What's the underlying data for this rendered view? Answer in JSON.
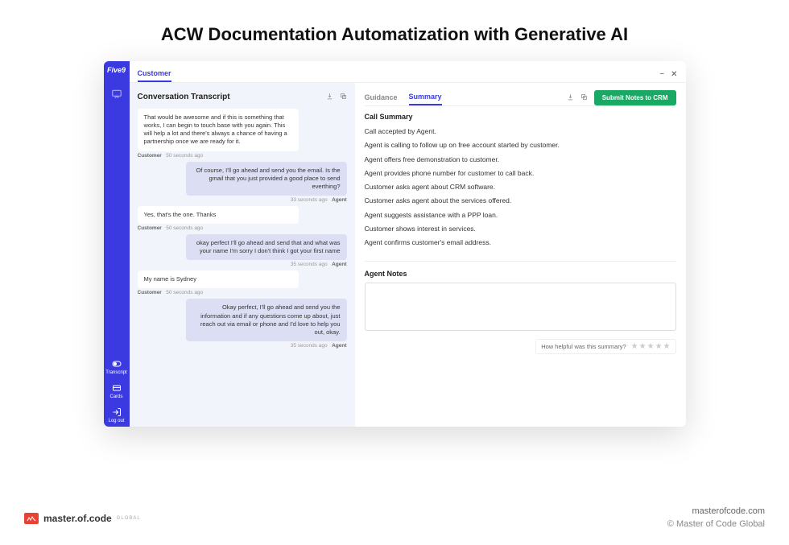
{
  "page_title": "ACW Documentation Automatization with Generative AI",
  "sidebar": {
    "logo_text": "Five9",
    "nav": [
      {
        "label": "Transcript"
      },
      {
        "label": "Cards"
      },
      {
        "label": "Log out"
      }
    ]
  },
  "topbar": {
    "tab_label": "Customer"
  },
  "transcript": {
    "title": "Conversation Transcript",
    "messages": [
      {
        "role": "Customer",
        "time": "50 seconds ago",
        "side": "customer",
        "text": "That would be awesome and if this is something that works, I can begin to touch base with you again. This will help a lot and there's always a chance of having a partnership once we are ready for it."
      },
      {
        "role": "Agent",
        "time": "33 seconds ago",
        "side": "agent",
        "text": "Of course, I'll go ahead and send you the email. Is the gmail that you just provided a good place to send everthing?"
      },
      {
        "role": "Customer",
        "time": "50 seconds ago",
        "side": "customer",
        "text": "Yes, that's the one. Thanks"
      },
      {
        "role": "Agent",
        "time": "35 seconds ago",
        "side": "agent",
        "text": "okay perfect I'll go ahead and send that and what was your name I'm sorry I don't think I got your first name"
      },
      {
        "role": "Customer",
        "time": "50 seconds ago",
        "side": "customer",
        "text": "My name is Sydney"
      },
      {
        "role": "Agent",
        "time": "35 seconds ago",
        "side": "agent",
        "text": "Okay perfect, I'll go ahead and send you the information and if any questions come up about, just reach out via email or phone and I'd love to help you out, okay."
      }
    ]
  },
  "summary_panel": {
    "tabs": {
      "guidance": "Guidance",
      "summary": "Summary"
    },
    "submit_label": "Submit Notes to CRM",
    "call_summary_title": "Call Summary",
    "summary_items": [
      "Call accepted by Agent.",
      "Agent is calling to follow up on free account started by customer.",
      "Agent offers free demonstration to customer.",
      "Agent provides phone number for customer to call back.",
      "Customer asks agent about CRM software.",
      "Customer asks agent about the services offered.",
      "Agent suggests assistance with a PPP loan.",
      "Customer shows interest in services.",
      "Agent confirms customer's email address."
    ],
    "agent_notes_title": "Agent Notes",
    "feedback_prompt": "How helpful was this summary?"
  },
  "footer": {
    "brand": "master.of.code",
    "brand_suffix": "GLOBAL",
    "domain": "masterofcode.com",
    "copyright": "© Master of Code Global"
  }
}
